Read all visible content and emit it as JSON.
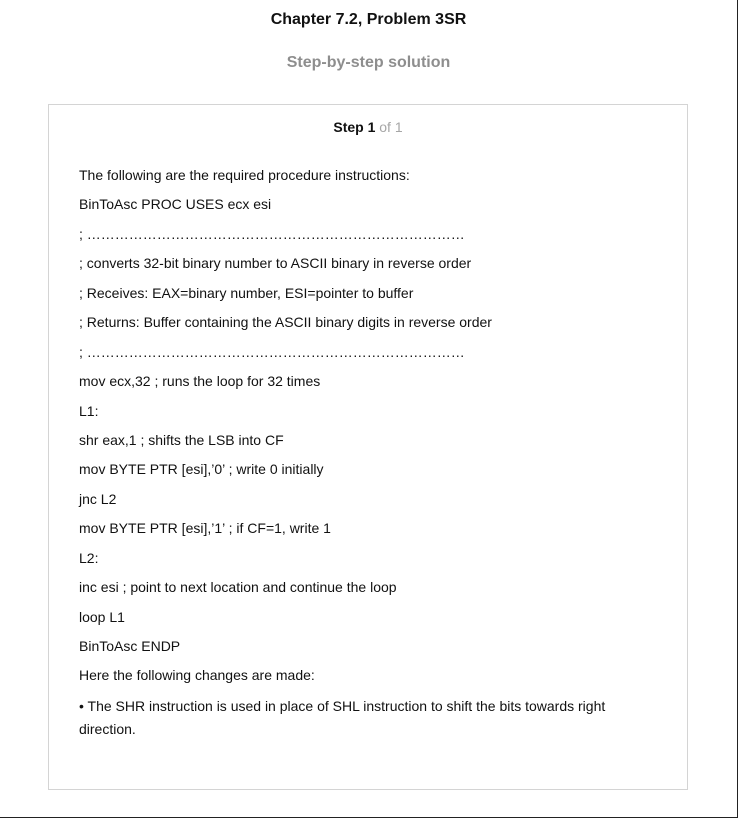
{
  "header": {
    "chapter_title": "Chapter 7.2, Problem 3SR",
    "subtitle": "Step-by-step solution"
  },
  "step": {
    "label": "Step 1",
    "count": "of 1"
  },
  "content": {
    "lines": [
      "The following are the required procedure instructions:",
      "BinToAsc PROC USES ecx esi",
      "; ………………………………………………………………………",
      "; converts 32-bit binary number to ASCII binary in reverse order",
      "; Receives: EAX=binary number, ESI=pointer to buffer",
      "; Returns: Buffer containing the ASCII binary digits in reverse order",
      "; ………………………………………………………………………",
      "mov ecx,32 ; runs the loop for 32 times",
      "L1:",
      "shr eax,1 ; shifts the LSB into CF",
      "mov BYTE PTR [esi],’0’ ; write 0 initially",
      "jnc L2",
      "mov BYTE PTR [esi],’1’ ; if CF=1, write 1",
      "L2:",
      "inc esi ; point to next location and continue the loop",
      "loop L1",
      "BinToAsc ENDP",
      "Here the following changes are made:"
    ],
    "bullet": "• The SHR instruction is used in place of SHL instruction to shift the bits towards right direction."
  }
}
